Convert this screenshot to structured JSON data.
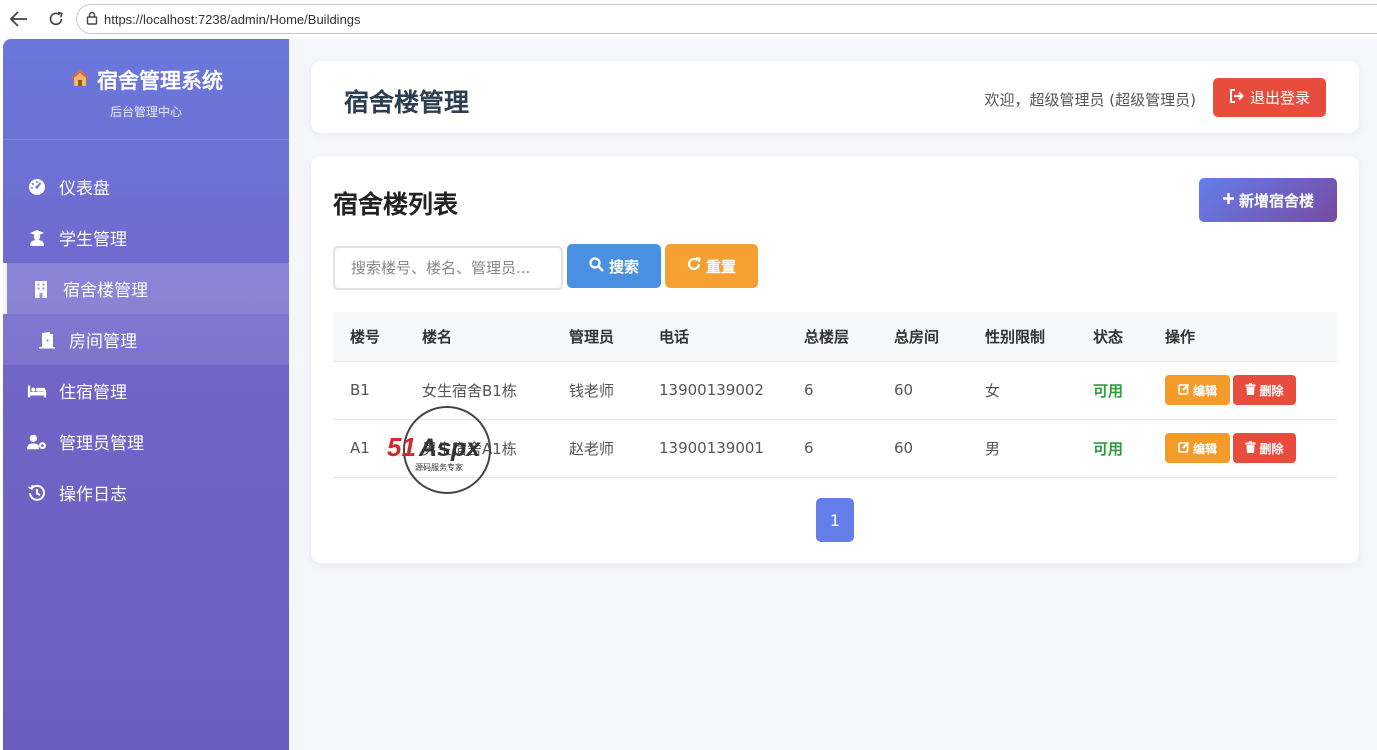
{
  "browser": {
    "url": "https://localhost:7238/admin/Home/Buildings"
  },
  "sidebar": {
    "title": "宿舍管理系统",
    "subtitle": "后台管理中心",
    "items": [
      {
        "label": "仪表盘",
        "icon": "dashboard-icon"
      },
      {
        "label": "学生管理",
        "icon": "student-icon"
      },
      {
        "label": "宿舍楼管理",
        "icon": "building-icon"
      },
      {
        "label": "房间管理",
        "icon": "door-icon"
      },
      {
        "label": "住宿管理",
        "icon": "bed-icon"
      },
      {
        "label": "管理员管理",
        "icon": "user-gear-icon"
      },
      {
        "label": "操作日志",
        "icon": "history-icon"
      }
    ]
  },
  "header": {
    "title": "宿舍楼管理",
    "welcome": "欢迎，超级管理员 (超级管理员)",
    "logout_label": "退出登录"
  },
  "main": {
    "title": "宿舍楼列表",
    "add_label": "新增宿舍楼",
    "search_placeholder": "搜索楼号、楼名、管理员...",
    "search_label": "搜索",
    "reset_label": "重置",
    "columns": [
      "楼号",
      "楼名",
      "管理员",
      "电话",
      "总楼层",
      "总房间",
      "性别限制",
      "状态",
      "操作"
    ],
    "rows": [
      {
        "code": "B1",
        "name": "女生宿舍B1栋",
        "manager": "钱老师",
        "phone": "13900139002",
        "floors": "6",
        "rooms": "60",
        "gender": "女",
        "status": "可用"
      },
      {
        "code": "A1",
        "name": "男生宿舍A1栋",
        "manager": "赵老师",
        "phone": "13900139001",
        "floors": "6",
        "rooms": "60",
        "gender": "男",
        "status": "可用"
      }
    ],
    "edit_label": "编辑",
    "delete_label": "删除",
    "page": "1"
  },
  "watermark": {
    "brand": "51Aspx",
    "slogan": "源码服务专家"
  },
  "colors": {
    "accent": "#667eea",
    "danger": "#e74c3c",
    "warning": "#f39c2a",
    "info": "#4a90e2",
    "success": "#2e9e3e"
  }
}
